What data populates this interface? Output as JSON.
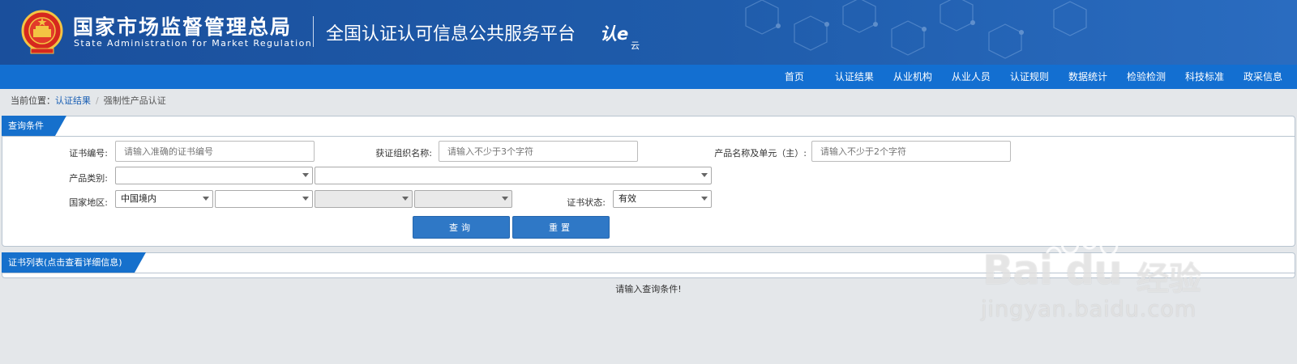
{
  "header": {
    "title_cn": "国家市场监督管理总局",
    "title_en": "State Administration  for  Market Regulation",
    "platform": "全国认证认可信息公共服务平台",
    "logo_text": "认e",
    "logo_sub": "云"
  },
  "nav": {
    "items": [
      {
        "label": "首页"
      },
      {
        "label": "认证结果"
      },
      {
        "label": "从业机构"
      },
      {
        "label": "从业人员"
      },
      {
        "label": "认证规则"
      },
      {
        "label": "数据统计"
      },
      {
        "label": "检验检测"
      },
      {
        "label": "科技标准"
      },
      {
        "label": "政采信息"
      }
    ]
  },
  "breadcrumb": {
    "prefix": "当前位置：",
    "link": "认证结果",
    "separator": "/",
    "current": "强制性产品认证"
  },
  "query_panel": {
    "tab_label": "查询条件",
    "cert_no_label": "证书编号:",
    "cert_no_placeholder": "请输入准确的证书编号",
    "org_label": "获证组织名称:",
    "org_placeholder": "请输入不少于3个字符",
    "product_label": "产品名称及单元（主）:",
    "product_placeholder": "请输入不少于2个字符",
    "category_label": "产品类别:",
    "category_value_1": "",
    "category_value_2": "",
    "region_label": "国家地区:",
    "region_value": "中国境内",
    "region_value_2": "",
    "region_value_3": "",
    "region_value_4": "",
    "status_label": "证书状态:",
    "status_value": "有效",
    "search_button": "查询",
    "reset_button": "重置"
  },
  "list_panel": {
    "tab_label": "证书列表(点击查看详细信息)",
    "empty_message": "请输入查询条件!"
  },
  "watermark": {
    "brand": "Bai du",
    "cn": "经验",
    "url": "jingyan.baidu.com"
  },
  "colors": {
    "header_bg": "#1f5cab",
    "nav_bg": "#136fd1",
    "tab_bg": "#1670cc",
    "button_bg": "#2f78c6"
  }
}
